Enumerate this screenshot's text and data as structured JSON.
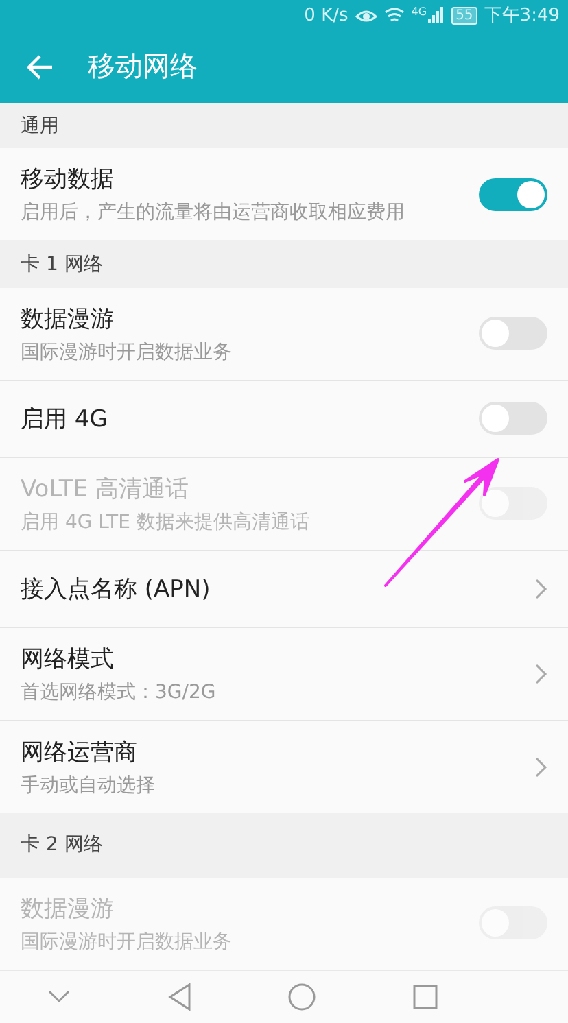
{
  "status_bar": {
    "speed": "0 K/s",
    "network": "4G",
    "battery": "55",
    "time": "下午3:49"
  },
  "app_bar": {
    "title": "移动网络"
  },
  "sections": [
    {
      "header": "通用",
      "items": [
        {
          "kind": "toggle",
          "title": "移动数据",
          "subtitle": "启用后，产生的流量将由运营商收取相应费用",
          "on": true,
          "disabled": false
        }
      ]
    },
    {
      "header": "卡 1 网络",
      "items": [
        {
          "kind": "toggle",
          "title": "数据漫游",
          "subtitle": "国际漫游时开启数据业务",
          "on": false,
          "disabled": false
        },
        {
          "kind": "toggle",
          "title": "启用 4G",
          "on": false,
          "disabled": false
        },
        {
          "kind": "toggle",
          "title": "VoLTE 高清通话",
          "subtitle": "启用 4G LTE 数据来提供高清通话",
          "on": false,
          "disabled": true
        },
        {
          "kind": "link",
          "title": "接入点名称 (APN)",
          "disabled": false
        },
        {
          "kind": "link",
          "title": "网络模式",
          "subtitle": "首选网络模式：3G/2G",
          "disabled": false
        },
        {
          "kind": "link",
          "title": "网络运营商",
          "subtitle": "手动或自动选择",
          "disabled": false
        }
      ]
    },
    {
      "header": "卡 2 网络",
      "items": [
        {
          "kind": "toggle",
          "title": "数据漫游",
          "subtitle": "国际漫游时开启数据业务",
          "on": false,
          "disabled": true
        }
      ]
    }
  ]
}
